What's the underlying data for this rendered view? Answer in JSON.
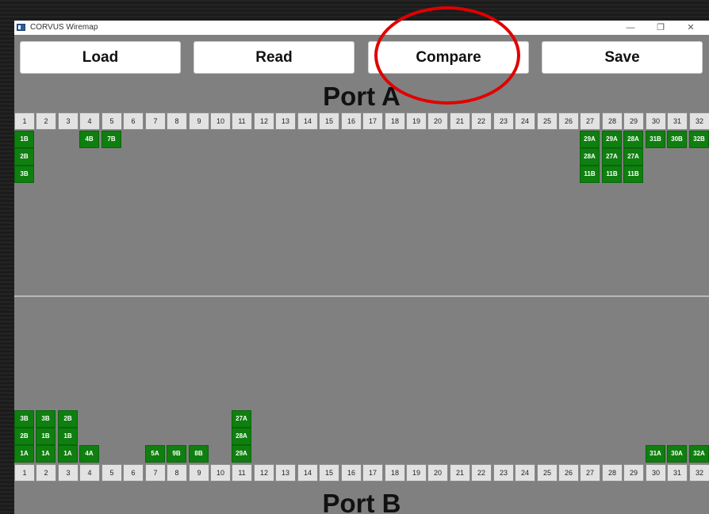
{
  "window": {
    "title": "CORVUS Wiremap",
    "controls": {
      "minimize": "—",
      "maximize": "❐",
      "close": "✕"
    }
  },
  "toolbar": {
    "load": "Load",
    "read": "Read",
    "compare": "Compare",
    "save": "Save"
  },
  "annotation": {
    "type": "circle",
    "target": "compare-button",
    "color": "#e00000"
  },
  "port_a": {
    "title": "Port A",
    "pins": [
      "1",
      "2",
      "3",
      "4",
      "5",
      "6",
      "7",
      "8",
      "9",
      "10",
      "11",
      "12",
      "13",
      "14",
      "15",
      "16",
      "17",
      "18",
      "19",
      "20",
      "21",
      "22",
      "23",
      "24",
      "25",
      "26",
      "27",
      "28",
      "29",
      "30",
      "31",
      "32"
    ],
    "wires": [
      {
        "pin": 1,
        "labels": [
          "1B",
          "2B",
          "3B"
        ]
      },
      {
        "pin": 4,
        "labels": [
          "4B"
        ]
      },
      {
        "pin": 5,
        "labels": [
          "7B"
        ]
      },
      {
        "pin": 27,
        "labels": [
          "29A",
          "28A",
          "11B"
        ]
      },
      {
        "pin": 28,
        "labels": [
          "29A",
          "27A",
          "11B"
        ]
      },
      {
        "pin": 29,
        "labels": [
          "28A",
          "27A",
          "11B"
        ]
      },
      {
        "pin": 30,
        "labels": [
          "31B"
        ]
      },
      {
        "pin": 31,
        "labels": [
          "30B"
        ]
      },
      {
        "pin": 32,
        "labels": [
          "32B"
        ]
      }
    ]
  },
  "port_b": {
    "title": "Port B",
    "pins": [
      "1",
      "2",
      "3",
      "4",
      "5",
      "6",
      "7",
      "8",
      "9",
      "10",
      "11",
      "12",
      "13",
      "14",
      "15",
      "16",
      "17",
      "18",
      "19",
      "20",
      "21",
      "22",
      "23",
      "24",
      "25",
      "26",
      "27",
      "28",
      "29",
      "30",
      "31",
      "32"
    ],
    "wires": [
      {
        "pin": 1,
        "labels": [
          "1A",
          "2B",
          "3B"
        ]
      },
      {
        "pin": 2,
        "labels": [
          "1A",
          "1B",
          "3B"
        ]
      },
      {
        "pin": 3,
        "labels": [
          "1A",
          "1B",
          "2B"
        ]
      },
      {
        "pin": 4,
        "labels": [
          "4A"
        ]
      },
      {
        "pin": 7,
        "labels": [
          "5A"
        ]
      },
      {
        "pin": 8,
        "labels": [
          "9B"
        ]
      },
      {
        "pin": 9,
        "labels": [
          "8B"
        ]
      },
      {
        "pin": 11,
        "labels": [
          "29A",
          "28A",
          "27A"
        ]
      },
      {
        "pin": 30,
        "labels": [
          "31A"
        ]
      },
      {
        "pin": 31,
        "labels": [
          "30A"
        ]
      },
      {
        "pin": 32,
        "labels": [
          "32A"
        ]
      }
    ]
  },
  "colors": {
    "wire_fill": "#0f7f0f",
    "pin_fill": "#e2e2e2",
    "panel_bg": "#808080"
  }
}
